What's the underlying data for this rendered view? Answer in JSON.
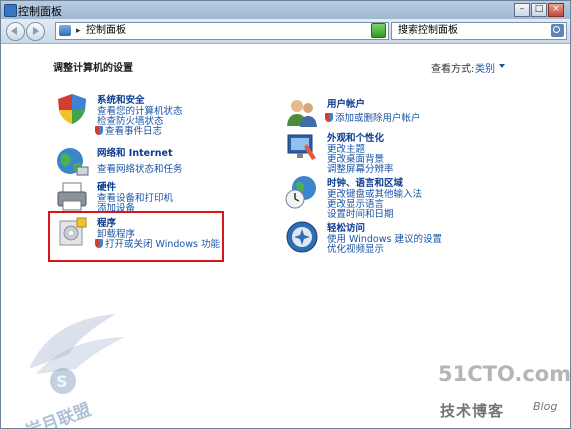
{
  "window": {
    "title": "控制面板"
  },
  "address": {
    "path_sep": "▸",
    "path": "控制面板"
  },
  "search": {
    "placeholder": "搜索控制面板"
  },
  "page": {
    "heading": "调整计算机的设置",
    "view_by_label": "查看方式:",
    "view_by_value": "类别"
  },
  "left_categories": [
    {
      "title": "系统和安全",
      "links": [
        "查看您的计算机状态",
        "检查防火墙状态",
        "查看事件日志"
      ]
    },
    {
      "title": "网络和 Internet",
      "links": [
        "查看网络状态和任务"
      ]
    },
    {
      "title": "硬件",
      "links": [
        "查看设备和打印机",
        "添加设备"
      ]
    },
    {
      "title": "程序",
      "links": [
        "卸载程序",
        "打开或关闭 Windows 功能"
      ]
    }
  ],
  "right_categories": [
    {
      "title": "用户帐户",
      "links": [
        "添加或删除用户帐户"
      ]
    },
    {
      "title": "外观和个性化",
      "links": [
        "更改主题",
        "更改桌面背景",
        "调整屏幕分辨率"
      ]
    },
    {
      "title": "时钟、语言和区域",
      "links": [
        "更改键盘或其他输入法",
        "更改显示语言",
        "设置时间和日期"
      ]
    },
    {
      "title": "轻松访问",
      "links": [
        "使用 Windows 建议的设置",
        "优化视频显示"
      ]
    }
  ],
  "watermark": {
    "brand": "51CTO.com",
    "sub": "技术博客",
    "blog": "Blog",
    "left_brand": "岩月联盟"
  },
  "colors": {
    "link": "#1a54a6",
    "title": "#0b3b8f",
    "highlight": "#d8151b"
  }
}
